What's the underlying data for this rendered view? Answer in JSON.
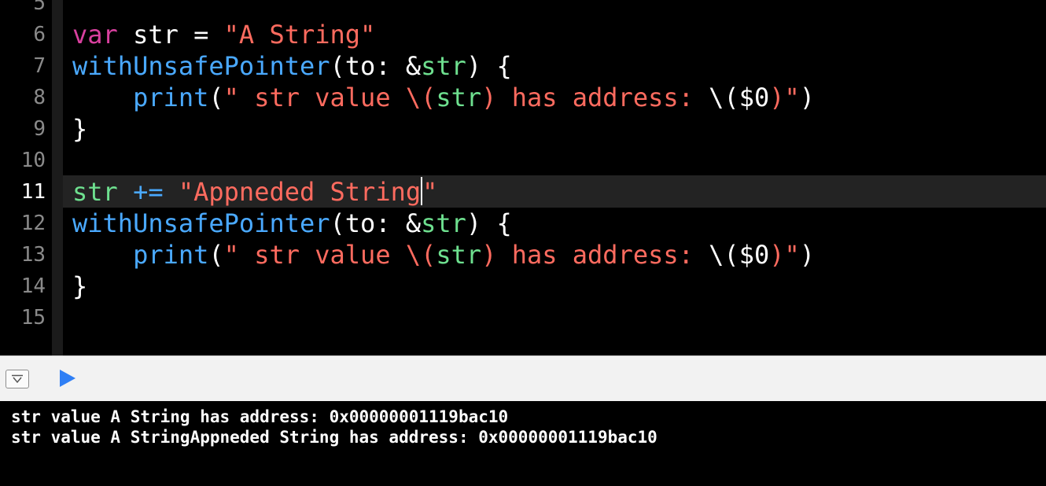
{
  "editor": {
    "line_numbers": [
      "5",
      "6",
      "7",
      "8",
      "9",
      "10",
      "11",
      "12",
      "13",
      "14",
      "15"
    ],
    "current_line": "11",
    "lines": {
      "l6": {
        "kw": "var",
        "id": " str = ",
        "str": "\"A String\""
      },
      "l7": {
        "fn": "withUnsafePointer",
        "rest1": "(to: &",
        "id": "str",
        "rest2": ") {"
      },
      "l8": {
        "indent": "    ",
        "fn": "print",
        "p1": "(",
        "s1": "\" str value \\",
        "p2": "(",
        "id": "str",
        "p3": ")",
        "s2": " has address: ",
        "p4": "\\(",
        "dollar": "$0",
        "p5": ")",
        "s3": "\"",
        "p6": ")"
      },
      "l9": {
        "text": "}"
      },
      "l11": {
        "id": "str",
        "op": " += ",
        "s1": "\"Appneded String",
        "s2": "\""
      },
      "l12": {
        "fn": "withUnsafePointer",
        "rest1": "(to: &",
        "id": "str",
        "rest2": ") {"
      },
      "l13": {
        "indent": "    ",
        "fn": "print",
        "p1": "(",
        "s1": "\" str value \\",
        "p2": "(",
        "id": "str",
        "p3": ")",
        "s2": " has address: ",
        "p4": "\\(",
        "dollar": "$0",
        "p5": ")",
        "s3": "\"",
        "p6": ")"
      },
      "l14": {
        "text": "}"
      }
    }
  },
  "console": {
    "lines": [
      "str value A String has address: 0x00000001119bac10",
      "str value A StringAppneded String has address: 0x00000001119bac10"
    ]
  },
  "toolbar": {
    "hide_icon": "hide-console-icon",
    "run_icon": "play-icon"
  },
  "colors": {
    "keyword": "#d9409f",
    "function": "#4aa9ff",
    "string": "#ff6b5f",
    "identifier": "#6ee08f",
    "background": "#000000"
  }
}
